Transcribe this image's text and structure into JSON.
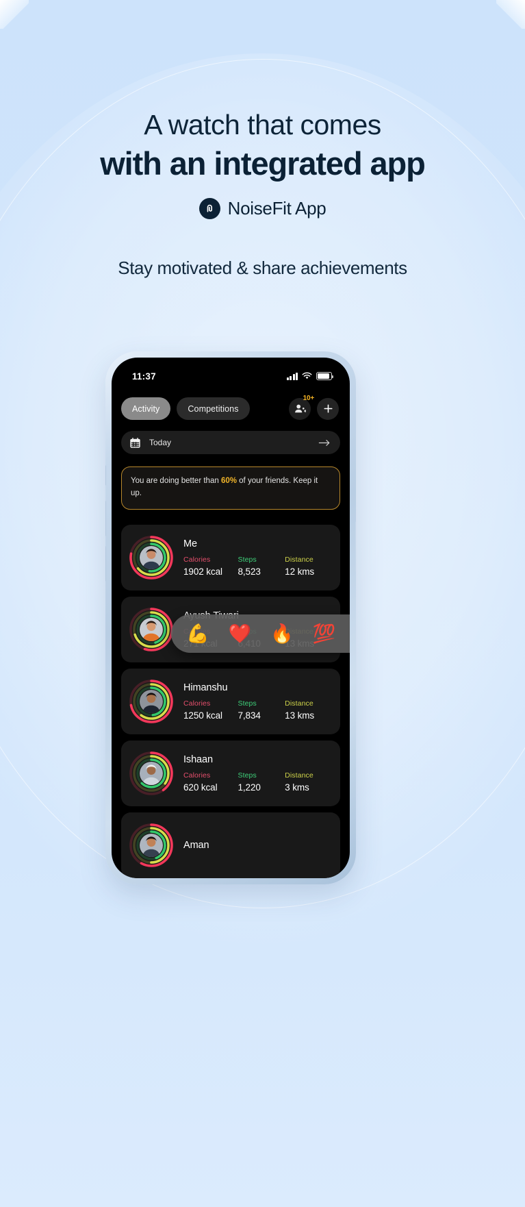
{
  "page": {
    "bg_color": "#cfe4fb",
    "headline_line1": "A watch that comes",
    "headline_line2": "with an integrated app",
    "brand_name": "NoiseFit App",
    "brand_logo_icon": "noisefit-logo-icon",
    "subheadline": "Stay motivated & share achievements",
    "headline_color": "#0b2135"
  },
  "phone": {
    "status_bar": {
      "time": "11:37",
      "cellular_icon": "signal-bars-icon",
      "wifi_icon": "wifi-icon",
      "battery_icon": "battery-icon"
    },
    "topbar": {
      "tabs": [
        {
          "label": "Activity",
          "active": true
        },
        {
          "label": "Competitions",
          "active": false
        }
      ],
      "friends_button": {
        "icon": "friends-add-icon",
        "badge": "10+",
        "badge_color": "#f5b324"
      },
      "add_button": {
        "icon": "plus-icon"
      }
    },
    "datebar": {
      "icon": "calendar-icon",
      "label": "Today",
      "next_icon": "arrow-right-icon"
    },
    "banner": {
      "text_before": "You are doing better than ",
      "highlight": "60%",
      "text_after": " of your friends. Keep it up.",
      "border_color": "#b9892c",
      "highlight_color": "#f0b429"
    },
    "stat_labels": {
      "calories": "Calories",
      "steps": "Steps",
      "distance": "Distance",
      "calories_color": "#e74f6d",
      "steps_color": "#3fd07a",
      "distance_color": "#cfd34a"
    },
    "friends": [
      {
        "name": "Me",
        "calories": "1902 kcal",
        "steps": "8,523",
        "distance": "12 kms",
        "avatar_icon": "avatar-me",
        "rings": {
          "calories_pct": 78,
          "steps_pct": 64,
          "distance_pct": 52
        }
      },
      {
        "name": "Ayush Tiwari",
        "calories": "271 kcal",
        "steps": "6,410",
        "distance": "13 kms",
        "avatar_icon": "avatar-ayush",
        "rings": {
          "calories_pct": 55,
          "steps_pct": 70,
          "distance_pct": 45
        }
      },
      {
        "name": "Himanshu",
        "calories": "1250 kcal",
        "steps": "7,834",
        "distance": "13 kms",
        "avatar_icon": "avatar-himanshu",
        "rings": {
          "calories_pct": 72,
          "steps_pct": 60,
          "distance_pct": 48
        }
      },
      {
        "name": "Ishaan",
        "calories": "620 kcal",
        "steps": "1,220",
        "distance": "3 kms",
        "avatar_icon": "avatar-ishaan",
        "rings": {
          "calories_pct": 40,
          "steps_pct": 35,
          "distance_pct": 62
        }
      },
      {
        "name": "Aman",
        "calories": "",
        "steps": "",
        "distance": "",
        "avatar_icon": "avatar-aman",
        "rings": {
          "calories_pct": 58,
          "steps_pct": 50,
          "distance_pct": 44
        }
      }
    ],
    "reactions": {
      "emojis": [
        "💪",
        "❤️",
        "🔥",
        "💯"
      ],
      "count": "6"
    }
  }
}
